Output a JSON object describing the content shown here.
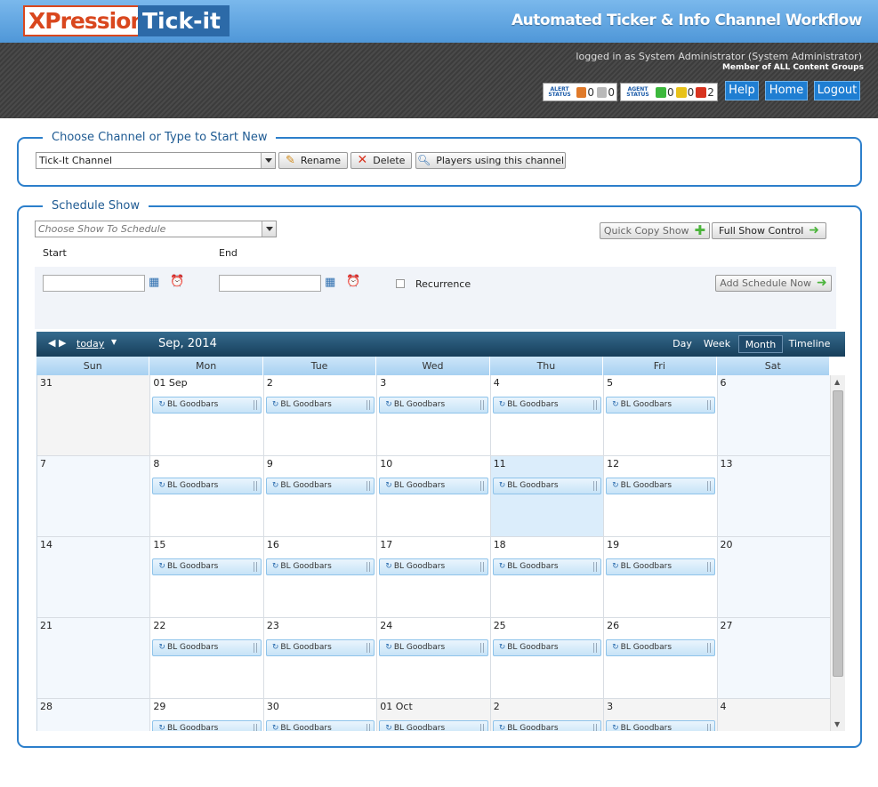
{
  "logo": {
    "part1": "XPression",
    "part2": "Tick-it"
  },
  "app_title": "Automated Ticker & Info Channel Workflow",
  "user": {
    "logged_in": "logged in as System Administrator (System Administrator)",
    "member": "Member of ALL Content Groups"
  },
  "alert_status": {
    "label": "ALERT STATUS",
    "count1": "0",
    "count2": "0"
  },
  "agent_status": {
    "label": "AGENT STATUS",
    "green": "0",
    "yellow": "0",
    "red": "2"
  },
  "nav_buttons": {
    "help": "Help",
    "home": "Home",
    "logout": "Logout"
  },
  "channel_section": {
    "legend": "Choose Channel or Type to Start New",
    "channel_value": "Tick-It Channel",
    "rename": "Rename",
    "delete": "Delete",
    "players": "Players using this channel"
  },
  "schedule_section": {
    "legend": "Schedule Show",
    "show_placeholder": "Choose Show To Schedule",
    "quick_copy": "Quick Copy Show",
    "full_control": "Full Show Control",
    "start_label": "Start",
    "end_label": "End",
    "recurrence": "Recurrence",
    "add_now": "Add Schedule Now"
  },
  "calendar": {
    "today": "today",
    "title": "Sep, 2014",
    "views": [
      "Day",
      "Week",
      "Month",
      "Timeline"
    ],
    "active_view": "Month",
    "days": [
      "Sun",
      "Mon",
      "Tue",
      "Wed",
      "Thu",
      "Fri",
      "Sat"
    ],
    "event_label": "BL Goodbars",
    "weeks": [
      [
        "31",
        "01 Sep",
        "2",
        "3",
        "4",
        "5",
        "6"
      ],
      [
        "7",
        "8",
        "9",
        "10",
        "11",
        "12",
        "13"
      ],
      [
        "14",
        "15",
        "16",
        "17",
        "18",
        "19",
        "20"
      ],
      [
        "21",
        "22",
        "23",
        "24",
        "25",
        "26",
        "27"
      ],
      [
        "28",
        "29",
        "30",
        "01 Oct",
        "2",
        "3",
        "4"
      ]
    ]
  },
  "colors": {
    "accent": "#2c7fcb",
    "logo_orange": "#d9471e",
    "button_blue": "#1f7ed2"
  }
}
